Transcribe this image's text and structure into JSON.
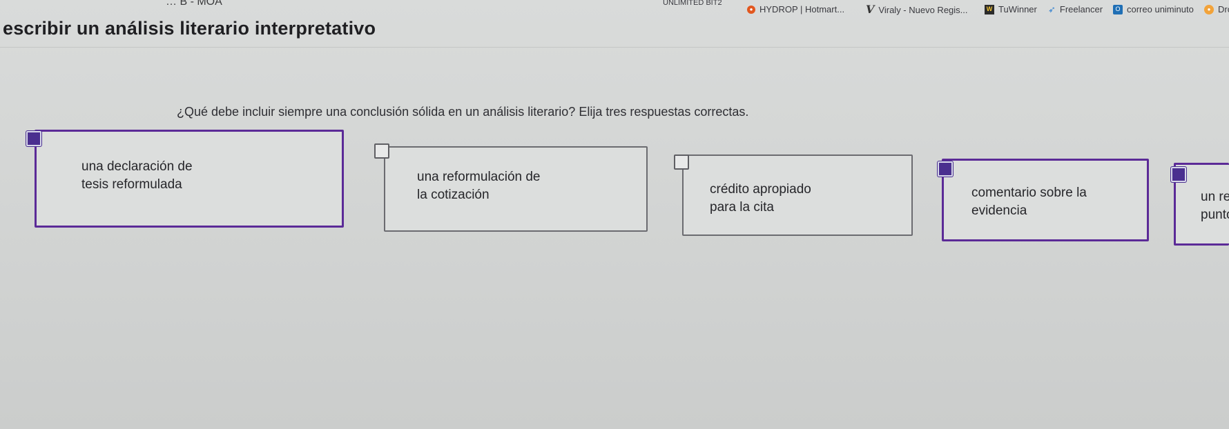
{
  "header": {
    "breadcrumb": "… B - MOA"
  },
  "bookmarks": [
    {
      "label": "UNLIMITED BIT2",
      "icon": "none"
    },
    {
      "label": "HYDROP | Hotmart...",
      "icon": "hydrop-icon"
    },
    {
      "label": "Viraly - Nuevo Regis...",
      "icon": "viraly-icon"
    },
    {
      "label": "TuWinner",
      "icon": "tuwinner-icon"
    },
    {
      "label": "Freelancer",
      "icon": "freelancer-icon"
    },
    {
      "label": "correo uniminuto",
      "icon": "outlook-icon"
    },
    {
      "label": "Dro",
      "icon": "dr-icon"
    }
  ],
  "page": {
    "title": "escribir un análisis literario interpretativo",
    "question": "¿Qué debe incluir siempre una conclusión sólida en un análisis literario? Elija tres respuestas correctas."
  },
  "options": [
    {
      "label": "una declaración de\ntesis reformulada",
      "checked": true
    },
    {
      "label": "una reformulación de\nla cotización",
      "checked": false
    },
    {
      "label": "crédito apropiado\npara la cita",
      "checked": false
    },
    {
      "label": "comentario sobre la\nevidencia",
      "checked": true
    },
    {
      "label": "un re\npunto",
      "checked": true
    }
  ],
  "colors": {
    "selected_border": "#5b2a97",
    "checked_fill": "#4a2f8f"
  }
}
